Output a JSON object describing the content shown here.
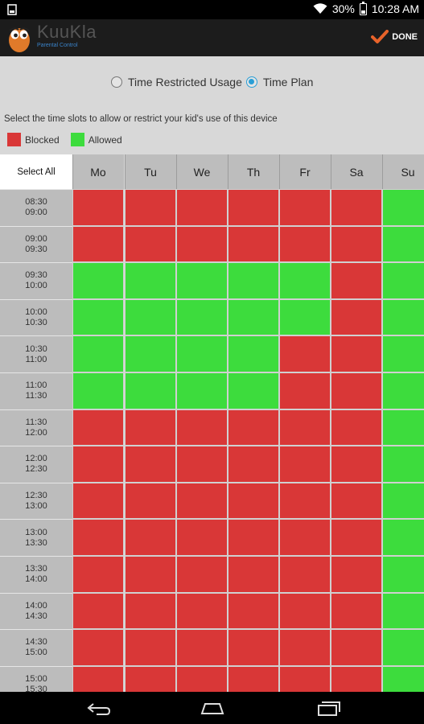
{
  "status_bar": {
    "battery": "30%",
    "time": "10:28 AM"
  },
  "app": {
    "name": "KuuKla",
    "subtitle": "Parental Control"
  },
  "done_label": "DONE",
  "mode_options": [
    {
      "label": "Time Restricted Usage",
      "selected": false
    },
    {
      "label": "Time Plan",
      "selected": true
    }
  ],
  "instruction": "Select the time slots to allow or restrict your kid's use of this device",
  "legend": [
    {
      "label": "Blocked",
      "color": "#d93737"
    },
    {
      "label": "Allowed",
      "color": "#3ddc3d"
    }
  ],
  "schedule": {
    "select_all_label": "Select All",
    "days": [
      "Mo",
      "Tu",
      "We",
      "Th",
      "Fr",
      "Sa",
      "Su"
    ],
    "slots": [
      {
        "start": "08:30",
        "end": "09:00",
        "allowed": [
          false,
          false,
          false,
          false,
          false,
          false,
          true
        ]
      },
      {
        "start": "09:00",
        "end": "09:30",
        "allowed": [
          false,
          false,
          false,
          false,
          false,
          false,
          true
        ]
      },
      {
        "start": "09:30",
        "end": "10:00",
        "allowed": [
          true,
          true,
          true,
          true,
          true,
          false,
          true
        ]
      },
      {
        "start": "10:00",
        "end": "10:30",
        "allowed": [
          true,
          true,
          true,
          true,
          true,
          false,
          true
        ]
      },
      {
        "start": "10:30",
        "end": "11:00",
        "allowed": [
          true,
          true,
          true,
          true,
          false,
          false,
          true
        ]
      },
      {
        "start": "11:00",
        "end": "11:30",
        "allowed": [
          true,
          true,
          true,
          true,
          false,
          false,
          true
        ]
      },
      {
        "start": "11:30",
        "end": "12:00",
        "allowed": [
          false,
          false,
          false,
          false,
          false,
          false,
          true
        ]
      },
      {
        "start": "12:00",
        "end": "12:30",
        "allowed": [
          false,
          false,
          false,
          false,
          false,
          false,
          true
        ]
      },
      {
        "start": "12:30",
        "end": "13:00",
        "allowed": [
          false,
          false,
          false,
          false,
          false,
          false,
          true
        ]
      },
      {
        "start": "13:00",
        "end": "13:30",
        "allowed": [
          false,
          false,
          false,
          false,
          false,
          false,
          true
        ]
      },
      {
        "start": "13:30",
        "end": "14:00",
        "allowed": [
          false,
          false,
          false,
          false,
          false,
          false,
          true
        ]
      },
      {
        "start": "14:00",
        "end": "14:30",
        "allowed": [
          false,
          false,
          false,
          false,
          false,
          false,
          true
        ]
      },
      {
        "start": "14:30",
        "end": "15:00",
        "allowed": [
          false,
          false,
          false,
          false,
          false,
          false,
          true
        ]
      },
      {
        "start": "15:00",
        "end": "15:30",
        "allowed": [
          false,
          false,
          false,
          false,
          false,
          false,
          true
        ]
      }
    ]
  },
  "colors": {
    "blocked": "#d93737",
    "allowed": "#3ddc3d",
    "accent": "#2a9fd6",
    "done_check": "#e8632a"
  }
}
